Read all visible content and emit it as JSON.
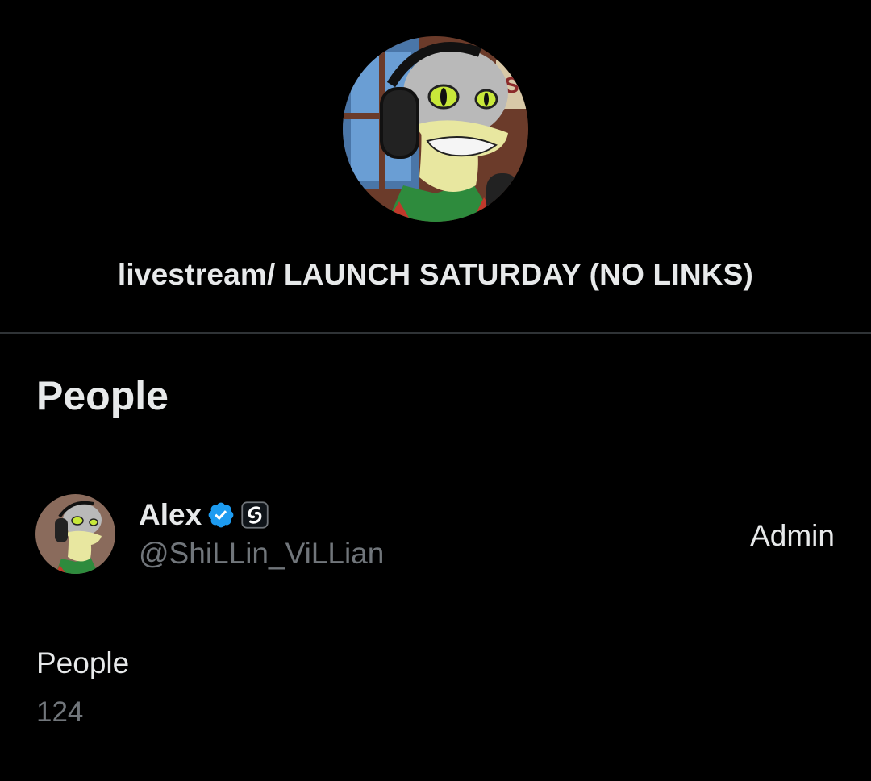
{
  "space": {
    "title": "livestream/ LAUNCH SATURDAY (NO LINKS)",
    "avatar_icon": "lizard-with-headphones-avatar"
  },
  "people_section": {
    "heading": "People",
    "members": [
      {
        "name": "Alex",
        "handle": "@ShiLLin_ViLLian",
        "role": "Admin",
        "verified_icon": "verified-badge-icon",
        "affiliate_icon": "affiliate-badge-icon"
      }
    ]
  },
  "stats": {
    "label": "People",
    "count": "124"
  },
  "colors": {
    "background": "#000000",
    "primary_text": "#e7e9ea",
    "secondary_text": "#71767b",
    "divider": "#2f3336",
    "verified_blue": "#1d9bf0"
  }
}
